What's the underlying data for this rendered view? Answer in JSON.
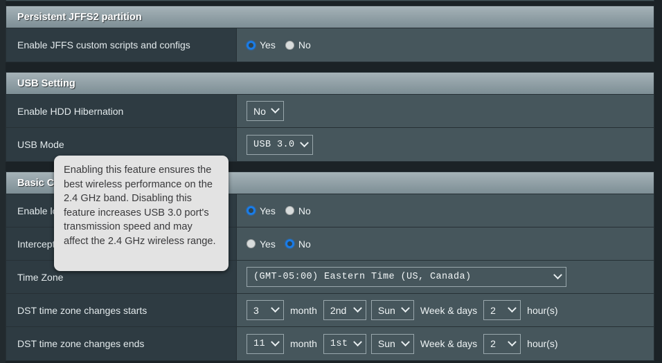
{
  "sections": [
    {
      "id": "jffs",
      "title": "Persistent JFFS2 partition",
      "rows": [
        {
          "label": "Enable JFFS custom scripts and configs",
          "control": "radio",
          "options": [
            "Yes",
            "No"
          ],
          "selected": "Yes"
        }
      ]
    },
    {
      "id": "usb",
      "title": "USB Setting",
      "rows": [
        {
          "label": "Enable HDD Hibernation",
          "control": "select",
          "value": "No"
        },
        {
          "label": "USB Mode",
          "control": "select",
          "value": "USB 3.0"
        }
      ]
    },
    {
      "id": "basic",
      "title": "Basic C",
      "rows": [
        {
          "label": "Enable lo",
          "control": "radio",
          "options": [
            "Yes",
            "No"
          ],
          "selected": "Yes"
        },
        {
          "label": "Intercept",
          "control": "radio",
          "options": [
            "Yes",
            "No"
          ],
          "selected": "No"
        },
        {
          "label": "Time Zone",
          "control": "select",
          "value": "(GMT-05:00) Eastern Time (US, Canada)"
        },
        {
          "label": "DST time zone changes starts",
          "control": "dst",
          "month": "3",
          "month_text": "month",
          "week": "2nd",
          "day": "Sun",
          "week_text": "Week & days",
          "hour": "2",
          "hour_text": "hour(s)"
        },
        {
          "label": "DST time zone changes ends",
          "control": "dst",
          "month": "11",
          "month_text": "month",
          "week": "1st",
          "day": "Sun",
          "week_text": "Week & days",
          "hour": "2",
          "hour_text": "hour(s)"
        }
      ]
    }
  ],
  "tooltip": {
    "text": "Enabling this feature ensures the best wireless performance on the 2.4 GHz band. Disabling this feature increases USB 3.0 port's transmission speed and may affect the 2.4 GHz wireless range."
  },
  "colors": {
    "panel_bg": "#46565c",
    "label_bg": "#2e3b42",
    "header_light": "#a6b3b8",
    "header_dark": "#7d8e95",
    "border": "#263035",
    "radio_on": "#1a7ce8",
    "tooltip_bg": "#e3e3e3",
    "page_bg": "#1b2226"
  }
}
